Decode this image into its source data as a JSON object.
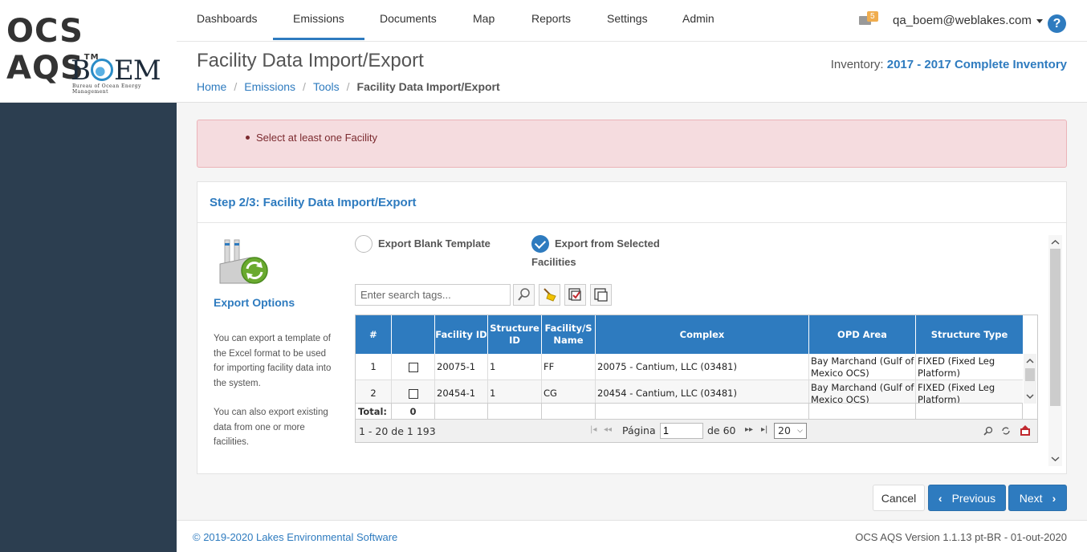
{
  "brand": {
    "app_name": "OCS AQS",
    "tm": "TM",
    "agency": "BOEM",
    "agency_subtitle": "Bureau of Ocean Energy Management"
  },
  "nav": {
    "items": [
      "Dashboards",
      "Emissions",
      "Documents",
      "Map",
      "Reports",
      "Settings",
      "Admin"
    ],
    "active": "Emissions",
    "mail_count": "5",
    "user": "qa_boem@weblakes.com",
    "help": "?"
  },
  "header": {
    "title": "Facility Data Import/Export",
    "breadcrumb": [
      "Home",
      "Emissions",
      "Tools",
      "Facility Data Import/Export"
    ],
    "inventory_label": "Inventory:",
    "inventory_value": "2017 - 2017 Complete Inventory"
  },
  "alert": {
    "message": "Select at least one Facility"
  },
  "panel": {
    "title": "Step 2/3: Facility Data Import/Export",
    "export_label": "Export Options",
    "desc_1": "You can export a template of the Excel format to be used for importing facility data into the system.",
    "desc_2": "You can also export existing data from one or more facilities.",
    "option_blank": "Export Blank Template",
    "option_selected": "Export from Selected Facilities",
    "selected_option": "Export from Selected Facilities",
    "search_placeholder": "Enter search tags..."
  },
  "grid": {
    "columns": [
      "#",
      "",
      "Facility ID",
      "Structure ID",
      "Facility/S Name",
      "Complex",
      "OPD Area",
      "Structure Type"
    ],
    "rows": [
      {
        "num": "1",
        "facility_id": "20075-1",
        "structure_id": "1",
        "name": "FF",
        "complex": "20075 - Cantium, LLC (03481)",
        "opd_area": "Bay Marchand (Gulf of Mexico OCS)",
        "structure_type": "FIXED (Fixed Leg Platform)"
      },
      {
        "num": "2",
        "facility_id": "20454-1",
        "structure_id": "1",
        "name": "CG",
        "complex": "20454 - Cantium, LLC (03481)",
        "opd_area": "Bay Marchand (Gulf of Mexico OCS)",
        "structure_type": "FIXED (Fixed Leg Platform)"
      }
    ],
    "total_label": "Total:",
    "total_value": "0",
    "pager": {
      "range": "1 - 20 de 1 193",
      "page_label": "Página",
      "page_value": "1",
      "of_label": "de 60",
      "page_size": "20"
    }
  },
  "buttons": {
    "cancel": "Cancel",
    "previous": "Previous",
    "next": "Next"
  },
  "footer": {
    "copyright": "© 2019-2020 Lakes Environmental Software",
    "version": "OCS AQS Version 1.1.13 pt-BR - 01-out-2020"
  },
  "colors": {
    "accent": "#2e7bbf",
    "sidebar": "#2c3e50",
    "alert_bg": "#f5dcdf",
    "alert_text": "#7b2a2f"
  }
}
